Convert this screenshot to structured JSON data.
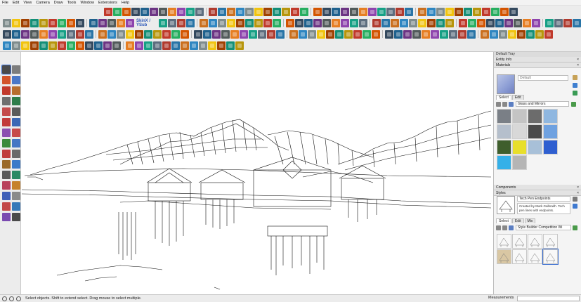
{
  "menu": [
    "File",
    "Edit",
    "View",
    "Camera",
    "Draw",
    "Tools",
    "Window",
    "Extensions",
    "Help"
  ],
  "toolbar": {
    "skin_label": "SkinX / YSub",
    "button_colors": [
      "#c0392b",
      "#e67e22",
      "#2e86c1",
      "#27ae60",
      "#8e44ad",
      "#7f8c8d",
      "#d35400",
      "#16a085",
      "#f1c40f",
      "#34495e",
      "#5d6d7e",
      "#a04000",
      "#1f618d",
      "#b03a2e",
      "#148f77",
      "#6c3483",
      "#2874a6",
      "#b7950b",
      "#515a5a",
      "#ca6f1e"
    ]
  },
  "left_tools": {
    "colors": [
      "#4a4a4a",
      "#7d7d7d",
      "#d3542b",
      "#4b78c8",
      "#c2392b",
      "#b86e2f",
      "#6e6e6e",
      "#2f7d4b",
      "#c44b4b",
      "#5b5b5b",
      "#c23b3b",
      "#3c68b5",
      "#8c4fb0",
      "#c74a4a",
      "#3a8a3a",
      "#4576c4",
      "#c03e3e",
      "#6a6a6a",
      "#9a6a2a",
      "#3b7ac9",
      "#5a5a5a",
      "#2b8a64",
      "#b8405b",
      "#c6812b",
      "#3e5fb8",
      "#8a8a8a",
      "#c24747",
      "#3778b8",
      "#7a4ab0",
      "#4a4a4a"
    ]
  },
  "tray": {
    "title": "Default Tray",
    "sections": {
      "entity_info": "Entity Info",
      "materials": "Materials",
      "components": "Components",
      "styles": "Styles"
    },
    "material_name": "Default",
    "tabs": [
      "Select",
      "Edit"
    ],
    "style_tabs": [
      "Select",
      "Edit",
      "Mix"
    ],
    "material_library": "Glass and Mirrors",
    "swatches": [
      "#7a7f86",
      "#c4c4c4",
      "#6c6c6c",
      "#8fb7e0",
      "#b5bfcc",
      "#d8d8d8",
      "#4a4a4a",
      "#6ea1e0",
      "#3f5e2c",
      "#e8df2b",
      "#a8c0d8",
      "#2f5fd0",
      "#35b0e8",
      "#b5b5b5"
    ],
    "style_name": "Tech Pen Endpoints",
    "style_description": "Created by Mark Galbraith. Tech pen lines with endpoints.",
    "style_library": "Style Builder Competition Wi"
  },
  "statusbar": {
    "message": "Select objects. Shift to extend select. Drag mouse to select multiple.",
    "measurements_label": "Measurements"
  }
}
